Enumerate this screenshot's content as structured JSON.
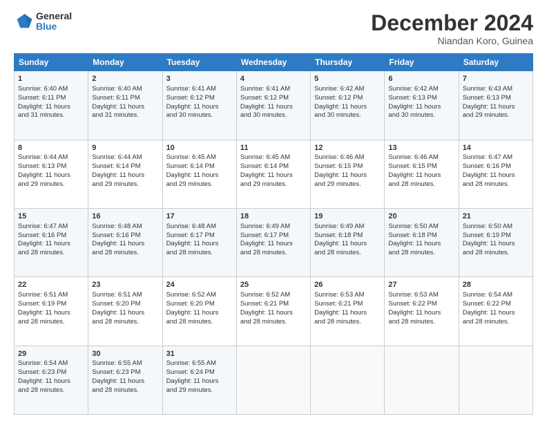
{
  "header": {
    "logo_general": "General",
    "logo_blue": "Blue",
    "month_title": "December 2024",
    "subtitle": "Niandan Koro, Guinea"
  },
  "days_of_week": [
    "Sunday",
    "Monday",
    "Tuesday",
    "Wednesday",
    "Thursday",
    "Friday",
    "Saturday"
  ],
  "weeks": [
    [
      {
        "day": "1",
        "lines": [
          "Sunrise: 6:40 AM",
          "Sunset: 6:11 PM",
          "Daylight: 11 hours",
          "and 31 minutes."
        ]
      },
      {
        "day": "2",
        "lines": [
          "Sunrise: 6:40 AM",
          "Sunset: 6:11 PM",
          "Daylight: 11 hours",
          "and 31 minutes."
        ]
      },
      {
        "day": "3",
        "lines": [
          "Sunrise: 6:41 AM",
          "Sunset: 6:12 PM",
          "Daylight: 11 hours",
          "and 30 minutes."
        ]
      },
      {
        "day": "4",
        "lines": [
          "Sunrise: 6:41 AM",
          "Sunset: 6:12 PM",
          "Daylight: 11 hours",
          "and 30 minutes."
        ]
      },
      {
        "day": "5",
        "lines": [
          "Sunrise: 6:42 AM",
          "Sunset: 6:12 PM",
          "Daylight: 11 hours",
          "and 30 minutes."
        ]
      },
      {
        "day": "6",
        "lines": [
          "Sunrise: 6:42 AM",
          "Sunset: 6:13 PM",
          "Daylight: 11 hours",
          "and 30 minutes."
        ]
      },
      {
        "day": "7",
        "lines": [
          "Sunrise: 6:43 AM",
          "Sunset: 6:13 PM",
          "Daylight: 11 hours",
          "and 29 minutes."
        ]
      }
    ],
    [
      {
        "day": "8",
        "lines": [
          "Sunrise: 6:44 AM",
          "Sunset: 6:13 PM",
          "Daylight: 11 hours",
          "and 29 minutes."
        ]
      },
      {
        "day": "9",
        "lines": [
          "Sunrise: 6:44 AM",
          "Sunset: 6:14 PM",
          "Daylight: 11 hours",
          "and 29 minutes."
        ]
      },
      {
        "day": "10",
        "lines": [
          "Sunrise: 6:45 AM",
          "Sunset: 6:14 PM",
          "Daylight: 11 hours",
          "and 29 minutes."
        ]
      },
      {
        "day": "11",
        "lines": [
          "Sunrise: 6:45 AM",
          "Sunset: 6:14 PM",
          "Daylight: 11 hours",
          "and 29 minutes."
        ]
      },
      {
        "day": "12",
        "lines": [
          "Sunrise: 6:46 AM",
          "Sunset: 6:15 PM",
          "Daylight: 11 hours",
          "and 29 minutes."
        ]
      },
      {
        "day": "13",
        "lines": [
          "Sunrise: 6:46 AM",
          "Sunset: 6:15 PM",
          "Daylight: 11 hours",
          "and 28 minutes."
        ]
      },
      {
        "day": "14",
        "lines": [
          "Sunrise: 6:47 AM",
          "Sunset: 6:16 PM",
          "Daylight: 11 hours",
          "and 28 minutes."
        ]
      }
    ],
    [
      {
        "day": "15",
        "lines": [
          "Sunrise: 6:47 AM",
          "Sunset: 6:16 PM",
          "Daylight: 11 hours",
          "and 28 minutes."
        ]
      },
      {
        "day": "16",
        "lines": [
          "Sunrise: 6:48 AM",
          "Sunset: 6:16 PM",
          "Daylight: 11 hours",
          "and 28 minutes."
        ]
      },
      {
        "day": "17",
        "lines": [
          "Sunrise: 6:48 AM",
          "Sunset: 6:17 PM",
          "Daylight: 11 hours",
          "and 28 minutes."
        ]
      },
      {
        "day": "18",
        "lines": [
          "Sunrise: 6:49 AM",
          "Sunset: 6:17 PM",
          "Daylight: 11 hours",
          "and 28 minutes."
        ]
      },
      {
        "day": "19",
        "lines": [
          "Sunrise: 6:49 AM",
          "Sunset: 6:18 PM",
          "Daylight: 11 hours",
          "and 28 minutes."
        ]
      },
      {
        "day": "20",
        "lines": [
          "Sunrise: 6:50 AM",
          "Sunset: 6:18 PM",
          "Daylight: 11 hours",
          "and 28 minutes."
        ]
      },
      {
        "day": "21",
        "lines": [
          "Sunrise: 6:50 AM",
          "Sunset: 6:19 PM",
          "Daylight: 11 hours",
          "and 28 minutes."
        ]
      }
    ],
    [
      {
        "day": "22",
        "lines": [
          "Sunrise: 6:51 AM",
          "Sunset: 6:19 PM",
          "Daylight: 11 hours",
          "and 28 minutes."
        ]
      },
      {
        "day": "23",
        "lines": [
          "Sunrise: 6:51 AM",
          "Sunset: 6:20 PM",
          "Daylight: 11 hours",
          "and 28 minutes."
        ]
      },
      {
        "day": "24",
        "lines": [
          "Sunrise: 6:52 AM",
          "Sunset: 6:20 PM",
          "Daylight: 11 hours",
          "and 28 minutes."
        ]
      },
      {
        "day": "25",
        "lines": [
          "Sunrise: 6:52 AM",
          "Sunset: 6:21 PM",
          "Daylight: 11 hours",
          "and 28 minutes."
        ]
      },
      {
        "day": "26",
        "lines": [
          "Sunrise: 6:53 AM",
          "Sunset: 6:21 PM",
          "Daylight: 11 hours",
          "and 28 minutes."
        ]
      },
      {
        "day": "27",
        "lines": [
          "Sunrise: 6:53 AM",
          "Sunset: 6:22 PM",
          "Daylight: 11 hours",
          "and 28 minutes."
        ]
      },
      {
        "day": "28",
        "lines": [
          "Sunrise: 6:54 AM",
          "Sunset: 6:22 PM",
          "Daylight: 11 hours",
          "and 28 minutes."
        ]
      }
    ],
    [
      {
        "day": "29",
        "lines": [
          "Sunrise: 6:54 AM",
          "Sunset: 6:23 PM",
          "Daylight: 11 hours",
          "and 28 minutes."
        ]
      },
      {
        "day": "30",
        "lines": [
          "Sunrise: 6:55 AM",
          "Sunset: 6:23 PM",
          "Daylight: 11 hours",
          "and 28 minutes."
        ]
      },
      {
        "day": "31",
        "lines": [
          "Sunrise: 6:55 AM",
          "Sunset: 6:24 PM",
          "Daylight: 11 hours",
          "and 29 minutes."
        ]
      },
      {
        "day": "",
        "lines": []
      },
      {
        "day": "",
        "lines": []
      },
      {
        "day": "",
        "lines": []
      },
      {
        "day": "",
        "lines": []
      }
    ]
  ]
}
